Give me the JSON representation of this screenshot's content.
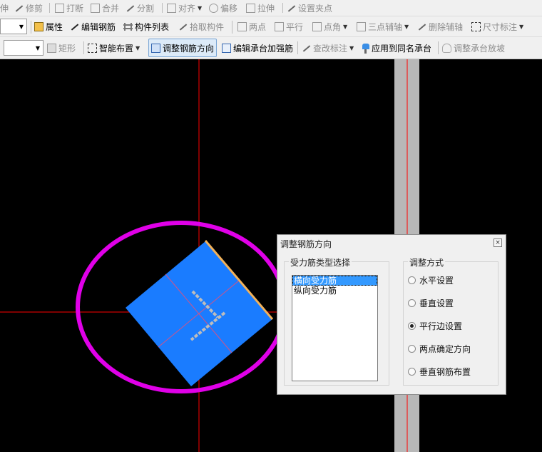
{
  "toolbar_row1": [
    {
      "label": "伸",
      "icon": "extend-icon"
    },
    {
      "label": "修剪",
      "icon": "trim-icon"
    },
    {
      "label": "打断",
      "icon": "break-icon"
    },
    {
      "label": "合并",
      "icon": "merge-icon"
    },
    {
      "label": "分割",
      "icon": "split-icon"
    },
    {
      "label": "对齐",
      "icon": "align-icon"
    },
    {
      "label": "偏移",
      "icon": "offset-icon"
    },
    {
      "label": "拉伸",
      "icon": "stretch-icon"
    },
    {
      "label": "设置夹点",
      "icon": "grip-icon"
    }
  ],
  "toolbar_row2": [
    {
      "label": "属性",
      "icon": "properties-icon"
    },
    {
      "label": "编辑钢筋",
      "icon": "edit-rebar-icon"
    },
    {
      "label": "构件列表",
      "icon": "component-list-icon"
    },
    {
      "label": "拾取构件",
      "icon": "pick-component-icon"
    },
    {
      "label": "两点",
      "icon": "two-point-icon"
    },
    {
      "label": "平行",
      "icon": "parallel-icon"
    },
    {
      "label": "点角",
      "icon": "point-angle-icon"
    },
    {
      "label": "三点辅轴",
      "icon": "three-point-axis-icon"
    },
    {
      "label": "删除辅轴",
      "icon": "delete-axis-icon"
    },
    {
      "label": "尺寸标注",
      "icon": "dimension-icon"
    }
  ],
  "toolbar_row3": [
    {
      "label": "矩形",
      "icon": "rectangle-icon"
    },
    {
      "label": "智能布置",
      "icon": "smart-layout-icon"
    },
    {
      "label": "调整钢筋方向",
      "icon": "adjust-rebar-direction-icon"
    },
    {
      "label": "编辑承台加强筋",
      "icon": "edit-cap-reinforcement-icon"
    },
    {
      "label": "查改标注",
      "icon": "check-annotation-icon"
    },
    {
      "label": "应用到同名承台",
      "icon": "apply-same-cap-icon"
    },
    {
      "label": "调整承台放坡",
      "icon": "adjust-cap-slope-icon"
    }
  ],
  "dialog": {
    "title": "调整钢筋方向",
    "close_label": "×",
    "left_group_title": "受力筋类型选择",
    "list_items": [
      "横向受力筋",
      "纵向受力筋"
    ],
    "selected_index": 0,
    "right_group_title": "调整方式",
    "options": [
      "水平设置",
      "垂直设置",
      "平行边设置",
      "两点确定方向",
      "垂直钢筋布置"
    ],
    "selected_option": 2
  },
  "colors": {
    "canvas_bg": "#000000",
    "axis_red": "#ff0000",
    "highlight_ellipse": "#e000e8",
    "cap_fill": "#1a7cff",
    "cap_edge": "#f2b25a",
    "rebar_gray": "#bdbdbd",
    "listbox_selected": "#3399ff"
  }
}
